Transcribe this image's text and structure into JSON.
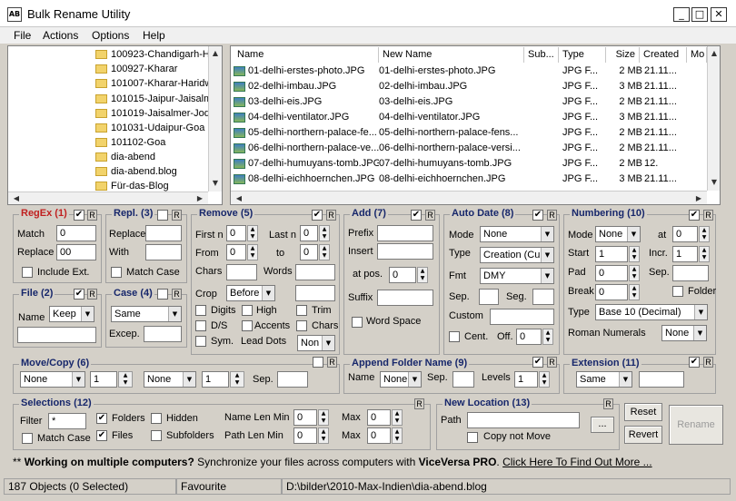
{
  "window": {
    "title": "Bulk Rename Utility",
    "icon_text": "AB"
  },
  "menu": [
    "File",
    "Actions",
    "Options",
    "Help"
  ],
  "tree": [
    "100923-Chandigarh-H",
    "100927-Kharar",
    "101007-Kharar-Haridw",
    "101015-Jaipur-Jaisalm",
    "101019-Jaisalmer-Jod",
    "101031-Udaipur-Goa",
    "101102-Goa",
    "dia-abend",
    "dia-abend.blog",
    "Für-das-Blog"
  ],
  "columns": [
    "Name",
    "New Name",
    "Sub...",
    "Type",
    "Size",
    "Created",
    "Mo"
  ],
  "files": [
    {
      "name": "01-delhi-erstes-photo.JPG",
      "new": "01-delhi-erstes-photo.JPG",
      "type": "JPG F...",
      "size": "2 MB",
      "created": "21.11..."
    },
    {
      "name": "02-delhi-imbau.JPG",
      "new": "02-delhi-imbau.JPG",
      "type": "JPG F...",
      "size": "3 MB",
      "created": "21.11..."
    },
    {
      "name": "03-delhi-eis.JPG",
      "new": "03-delhi-eis.JPG",
      "type": "JPG F...",
      "size": "2 MB",
      "created": "21.11..."
    },
    {
      "name": "04-delhi-ventilator.JPG",
      "new": "04-delhi-ventilator.JPG",
      "type": "JPG F...",
      "size": "3 MB",
      "created": "21.11..."
    },
    {
      "name": "05-delhi-northern-palace-fe...",
      "new": "05-delhi-northern-palace-fens...",
      "type": "JPG F...",
      "size": "2 MB",
      "created": "21.11..."
    },
    {
      "name": "06-delhi-northern-palace-ve...",
      "new": "06-delhi-northern-palace-versi...",
      "type": "JPG F...",
      "size": "2 MB",
      "created": "21.11..."
    },
    {
      "name": "07-delhi-humuyans-tomb.JPG",
      "new": "07-delhi-humuyans-tomb.JPG",
      "type": "JPG F...",
      "size": "2 MB",
      "created": "12."
    },
    {
      "name": "08-delhi-eichhoernchen.JPG",
      "new": "08-delhi-eichhoernchen.JPG",
      "type": "JPG F...",
      "size": "3 MB",
      "created": "21.11..."
    }
  ],
  "regex": {
    "title": "RegEx (1)",
    "match_label": "Match",
    "match_value": "0",
    "replace_label": "Replace",
    "replace_value": "00",
    "include_ext": "Include Ext."
  },
  "repl": {
    "title": "Repl. (3)",
    "replace_label": "Replace",
    "with_label": "With",
    "match_case": "Match Case"
  },
  "remove": {
    "title": "Remove (5)",
    "first_n": "First n",
    "first_n_val": "0",
    "last_n": "Last n",
    "last_n_val": "0",
    "from": "From",
    "from_val": "0",
    "to": "to",
    "to_val": "0",
    "chars": "Chars",
    "words": "Words",
    "crop": "Crop",
    "crop_val": "Before",
    "digits": "Digits",
    "high": "High",
    "trim": "Trim",
    "ds": "D/S",
    "accents": "Accents",
    "chars2": "Chars",
    "sym": "Sym.",
    "lead_dots": "Lead Dots",
    "non_val": "Non"
  },
  "add": {
    "title": "Add (7)",
    "prefix": "Prefix",
    "insert": "Insert",
    "at_pos": "at pos.",
    "at_pos_val": "0",
    "suffix": "Suffix",
    "word_space": "Word Space"
  },
  "autodate": {
    "title": "Auto Date (8)",
    "mode": "Mode",
    "mode_val": "None",
    "type": "Type",
    "type_val": "Creation (Cur",
    "fmt": "Fmt",
    "fmt_val": "DMY",
    "sep": "Sep.",
    "seg": "Seg.",
    "custom": "Custom",
    "cent": "Cent.",
    "off": "Off.",
    "off_val": "0"
  },
  "numbering": {
    "title": "Numbering (10)",
    "mode": "Mode",
    "mode_val": "None",
    "at": "at",
    "at_val": "0",
    "start": "Start",
    "start_val": "1",
    "incr": "Incr.",
    "incr_val": "1",
    "pad": "Pad",
    "pad_val": "0",
    "sep": "Sep.",
    "break": "Break",
    "break_val": "0",
    "folder": "Folder",
    "type": "Type",
    "type_val": "Base 10 (Decimal)",
    "roman": "Roman Numerals",
    "roman_val": "None"
  },
  "file": {
    "title": "File (2)",
    "name": "Name",
    "name_val": "Keep"
  },
  "case": {
    "title": "Case (4)",
    "case_val": "Same",
    "excep": "Excep."
  },
  "movecopy": {
    "title": "Move/Copy (6)",
    "sel1": "None",
    "num1": "1",
    "sel2": "None",
    "num2": "1",
    "sep": "Sep."
  },
  "append": {
    "title": "Append Folder Name (9)",
    "name": "Name",
    "name_val": "None",
    "sep": "Sep.",
    "levels": "Levels",
    "levels_val": "1"
  },
  "extension": {
    "title": "Extension (11)",
    "ext_val": "Same"
  },
  "selections": {
    "title": "Selections (12)",
    "filter": "Filter",
    "filter_val": "*",
    "folders": "Folders",
    "hidden": "Hidden",
    "name_len_min": "Name Len Min",
    "name_len_val": "0",
    "max": "Max",
    "max_val": "0",
    "match_case": "Match Case",
    "files": "Files",
    "subfolders": "Subfolders",
    "path_len_min": "Path Len Min",
    "path_len_val": "0",
    "max2": "Max",
    "max2_val": "0"
  },
  "newloc": {
    "title": "New Location (13)",
    "path": "Path",
    "browse": "...",
    "copy_not_move": "Copy not Move"
  },
  "buttons": {
    "reset": "Reset",
    "revert": "Revert",
    "rename": "Rename",
    "r": "R"
  },
  "promo": {
    "prefix": "** ",
    "bold1": "Working on multiple computers?",
    "text": " Synchronize your files across computers with ",
    "bold2": "ViceVersa PRO",
    "dot": ". ",
    "link": "Click Here To Find Out More ..."
  },
  "status": {
    "objects": "187 Objects (0 Selected)",
    "favourite": "Favourite",
    "path": "D:\\bilder\\2010-Max-Indien\\dia-abend.blog"
  }
}
